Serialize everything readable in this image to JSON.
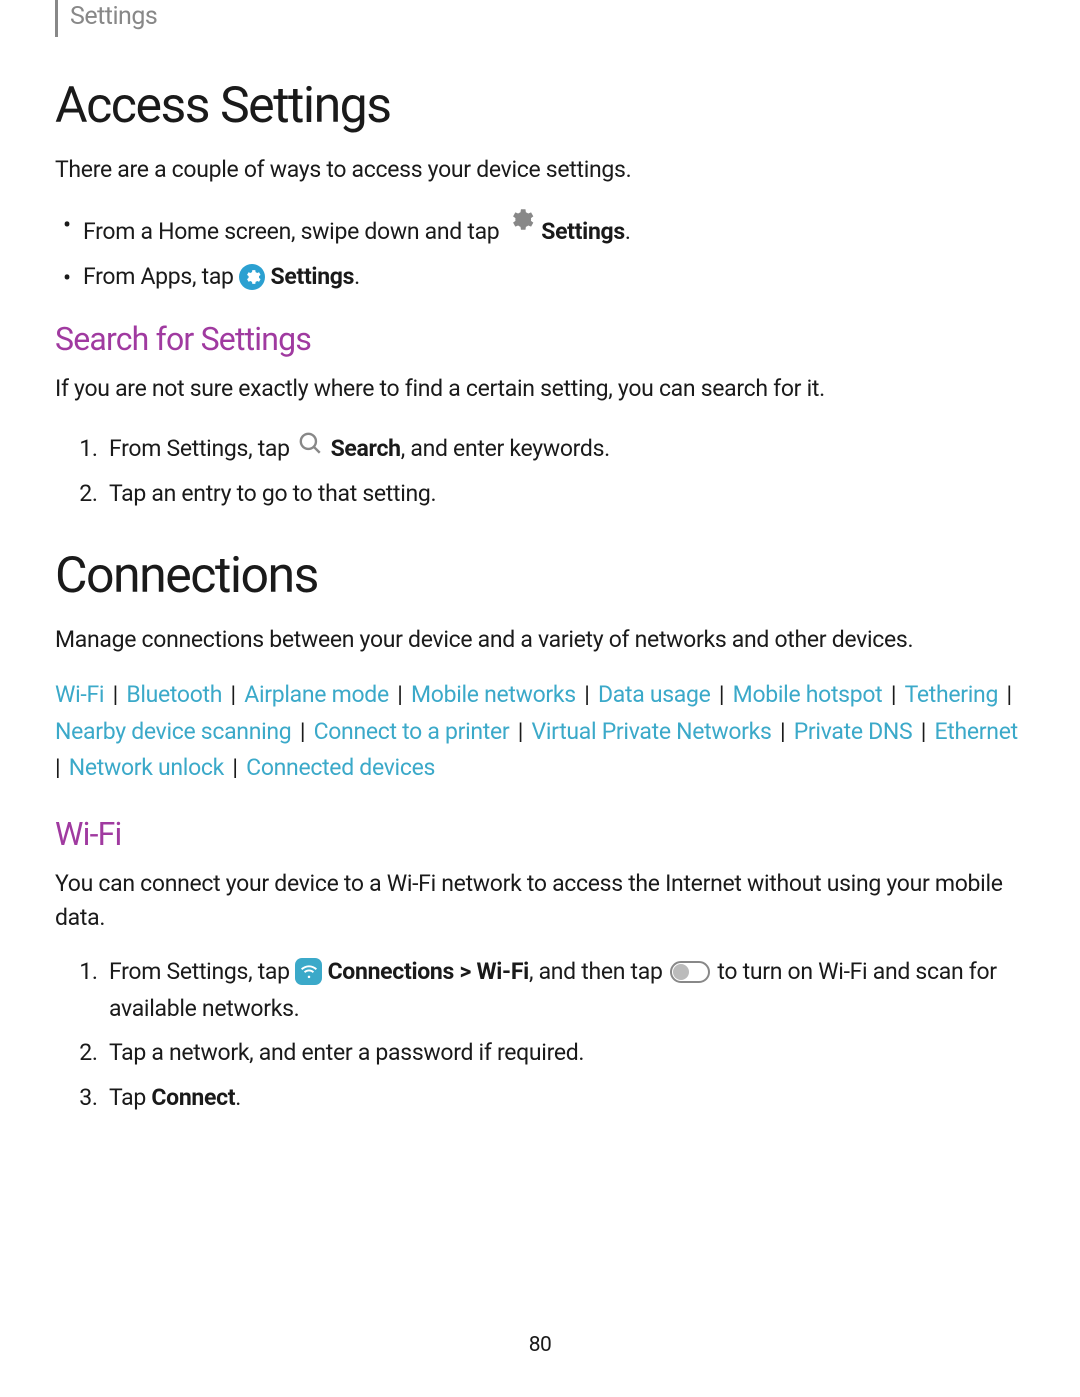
{
  "header": "Settings",
  "h1_access": "Access Settings",
  "p_access": "There are a couple of ways to access your device settings.",
  "bullet1_pre": "From a Home screen, swipe down and tap ",
  "bullet1_bold": "Settings",
  "bullet2_pre": "From Apps, tap ",
  "bullet2_bold": "Settings",
  "h2_search": "Search for Settings",
  "p_search": "If you are not sure exactly where to find a certain setting, you can search for it.",
  "ol_search_1_pre": "From Settings, tap ",
  "ol_search_1_bold": "Search",
  "ol_search_1_post": ", and enter keywords.",
  "ol_search_2": "Tap an entry to go to that setting.",
  "h1_connections": "Connections",
  "p_connections": "Manage connections between your device and a variety of networks and other devices.",
  "links": {
    "wifi": "Wi-Fi",
    "bluetooth": "Bluetooth",
    "airplane": "Airplane mode",
    "mobile_networks": "Mobile networks",
    "data_usage": "Data usage",
    "mobile_hotspot": "Mobile hotspot",
    "tethering": "Tethering",
    "nearby": "Nearby device scanning",
    "printer": "Connect to a printer",
    "vpn": "Virtual Private Networks",
    "private_dns": "Private DNS",
    "ethernet": "Ethernet",
    "network_unlock": "Network unlock",
    "connected": "Connected devices"
  },
  "sep": " | ",
  "h2_wifi": "Wi-Fi",
  "p_wifi": "You can connect your device to a Wi-Fi network to access the Internet without using your mobile data.",
  "ol_wifi_1_pre": "From Settings, tap ",
  "ol_wifi_1_bold": "Connections > Wi-Fi",
  "ol_wifi_1_mid": ", and then tap ",
  "ol_wifi_1_post": " to turn on Wi-Fi and scan for available networks.",
  "ol_wifi_2": "Tap a network, and enter a password if required.",
  "ol_wifi_3_pre": "Tap ",
  "ol_wifi_3_bold": "Connect",
  "period": ".",
  "page_number": "80"
}
